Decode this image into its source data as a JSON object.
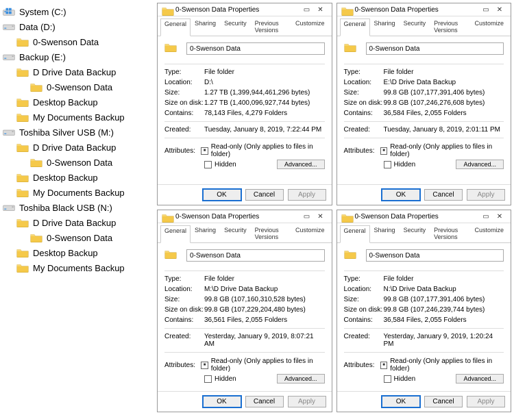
{
  "tree": [
    {
      "icon": "disk-system",
      "label": "System (C:)",
      "indent": 0
    },
    {
      "icon": "disk",
      "label": "Data (D:)",
      "indent": 0
    },
    {
      "icon": "folder",
      "label": "0-Swenson Data",
      "indent": 1
    },
    {
      "icon": "disk",
      "label": "Backup (E:)",
      "indent": 0
    },
    {
      "icon": "folder",
      "label": "D Drive Data Backup",
      "indent": 1
    },
    {
      "icon": "folder",
      "label": "0-Swenson Data",
      "indent": 2
    },
    {
      "icon": "folder",
      "label": "Desktop Backup",
      "indent": 1
    },
    {
      "icon": "folder",
      "label": "My Documents Backup",
      "indent": 1
    },
    {
      "icon": "disk",
      "label": "Toshiba Silver USB (M:)",
      "indent": 0
    },
    {
      "icon": "folder",
      "label": "D Drive Data Backup",
      "indent": 1
    },
    {
      "icon": "folder",
      "label": "0-Swenson Data",
      "indent": 2
    },
    {
      "icon": "folder",
      "label": "Desktop Backup",
      "indent": 1
    },
    {
      "icon": "folder",
      "label": "My Documents Backup",
      "indent": 1
    },
    {
      "icon": "disk",
      "label": "Toshiba Black USB (N:)",
      "indent": 0
    },
    {
      "icon": "folder",
      "label": "D Drive Data Backup",
      "indent": 1
    },
    {
      "icon": "folder",
      "label": "0-Swenson Data",
      "indent": 2
    },
    {
      "icon": "folder",
      "label": "Desktop Backup",
      "indent": 1
    },
    {
      "icon": "folder",
      "label": "My Documents Backup",
      "indent": 1
    }
  ],
  "dialog_common": {
    "title": "0-Swenson Data Properties",
    "tabs": [
      "General",
      "Sharing",
      "Security",
      "Previous Versions",
      "Customize"
    ],
    "name": "0-Swenson Data",
    "type_label": "Type:",
    "type_value": "File folder",
    "location_label": "Location:",
    "size_label": "Size:",
    "sizeondisk_label": "Size on disk:",
    "contains_label": "Contains:",
    "created_label": "Created:",
    "attributes_label": "Attributes:",
    "readonly_label": "Read-only (Only applies to files in folder)",
    "hidden_label": "Hidden",
    "advanced_label": "Advanced...",
    "ok": "OK",
    "cancel": "Cancel",
    "apply": "Apply"
  },
  "dialogs": [
    {
      "location": "D:\\",
      "size": "1.27 TB (1,399,944,461,296 bytes)",
      "sizeondisk": "1.27 TB (1,400,096,927,744 bytes)",
      "contains": "78,143 Files, 4,279 Folders",
      "created": "Tuesday, January 8, 2019, 7:22:44 PM"
    },
    {
      "location": "E:\\D Drive Data Backup",
      "size": "99.8 GB (107,177,391,406 bytes)",
      "sizeondisk": "99.8 GB (107,246,276,608 bytes)",
      "contains": "36,584 Files, 2,055 Folders",
      "created": "Tuesday, January 8, 2019, 2:01:11 PM"
    },
    {
      "location": "M:\\D Drive Data Backup",
      "size": "99.8 GB (107,160,310,528 bytes)",
      "sizeondisk": "99.8 GB (107,229,204,480 bytes)",
      "contains": "36,561 Files, 2,055 Folders",
      "created": "Yesterday, January 9, 2019, 8:07:21 AM"
    },
    {
      "location": "N:\\D Drive Data Backup",
      "size": "99.8 GB (107,177,391,406 bytes)",
      "sizeondisk": "99.8 GB (107,246,239,744 bytes)",
      "contains": "36,584 Files, 2,055 Folders",
      "created": "Yesterday, January 9, 2019, 1:20:24 PM"
    }
  ]
}
